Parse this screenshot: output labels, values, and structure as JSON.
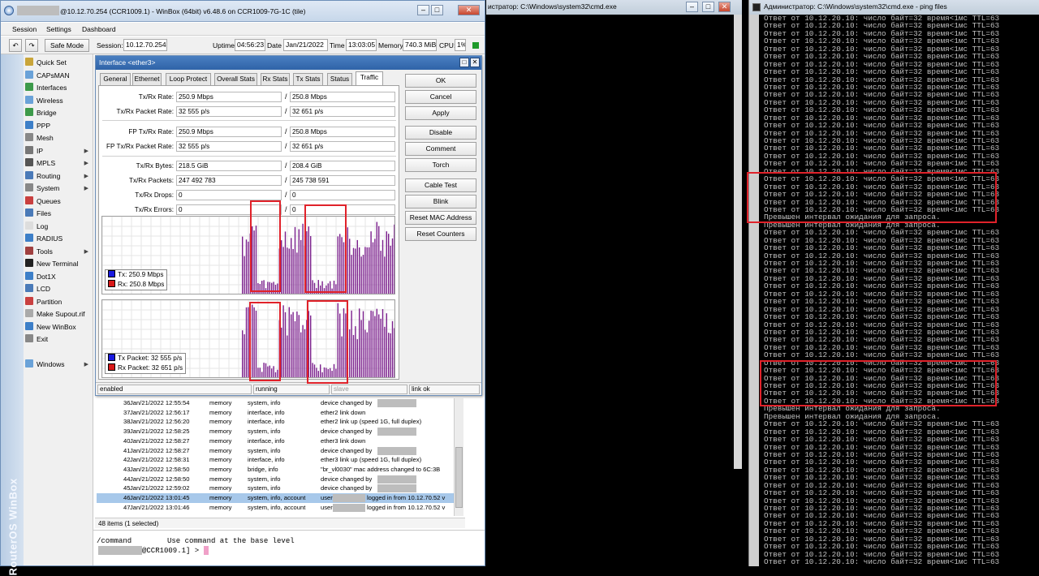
{
  "winbox": {
    "title_prefix": "@10.12.70.254 (CCR1009.1) - WinBox (64bit) v6.48.6 on CCR1009-7G-1C (tile)",
    "menu": [
      "Session",
      "Settings",
      "Dashboard"
    ],
    "toolbar": {
      "safe_mode": "Safe Mode",
      "session_label": "Session:",
      "session_value": "10.12.70.254",
      "uptime_label": "Uptime",
      "uptime_value": "04:56:23",
      "date_label": "Date",
      "date_value": "Jan/21/2022",
      "time_label": "Time",
      "time_value": "13:03:05",
      "memory_label": "Memory:",
      "memory_value": "740.3 MiB",
      "cpu_label": "CPU:",
      "cpu_value": "1%"
    },
    "vertical_brand": "RouterOS WinBox",
    "sidebar": [
      {
        "label": "Quick Set",
        "icon": "quickset-icon",
        "color": "#c9a53a",
        "arrow": false
      },
      {
        "label": "CAPsMAN",
        "icon": "capsman-icon",
        "color": "#6aa2d8",
        "arrow": false
      },
      {
        "label": "Interfaces",
        "icon": "interfaces-icon",
        "color": "#3d9a4a",
        "arrow": false
      },
      {
        "label": "Wireless",
        "icon": "wireless-icon",
        "color": "#6aa2d8",
        "arrow": false
      },
      {
        "label": "Bridge",
        "icon": "bridge-icon",
        "color": "#3d9a4a",
        "arrow": false
      },
      {
        "label": "PPP",
        "icon": "ppp-icon",
        "color": "#3d7fc8",
        "arrow": false
      },
      {
        "label": "Mesh",
        "icon": "mesh-icon",
        "color": "#888888",
        "arrow": false
      },
      {
        "label": "IP",
        "icon": "ip-icon",
        "color": "#777777",
        "arrow": true
      },
      {
        "label": "MPLS",
        "icon": "mpls-icon",
        "color": "#555555",
        "arrow": true
      },
      {
        "label": "Routing",
        "icon": "routing-icon",
        "color": "#4a7ab8",
        "arrow": true
      },
      {
        "label": "System",
        "icon": "system-icon",
        "color": "#888888",
        "arrow": true
      },
      {
        "label": "Queues",
        "icon": "queues-icon",
        "color": "#c94040",
        "arrow": false
      },
      {
        "label": "Files",
        "icon": "files-icon",
        "color": "#4a7ab8",
        "arrow": false
      },
      {
        "label": "Log",
        "icon": "log-icon",
        "color": "#dddddd",
        "arrow": false
      },
      {
        "label": "RADIUS",
        "icon": "radius-icon",
        "color": "#3d7fc8",
        "arrow": false
      },
      {
        "label": "Tools",
        "icon": "tools-icon",
        "color": "#a04040",
        "arrow": true
      },
      {
        "label": "New Terminal",
        "icon": "terminal-icon",
        "color": "#222222",
        "arrow": false
      },
      {
        "label": "Dot1X",
        "icon": "dot1x-icon",
        "color": "#3d7fc8",
        "arrow": false
      },
      {
        "label": "LCD",
        "icon": "lcd-icon",
        "color": "#4a7ab8",
        "arrow": false
      },
      {
        "label": "Partition",
        "icon": "partition-icon",
        "color": "#c94040",
        "arrow": false
      },
      {
        "label": "Make Supout.rif",
        "icon": "supout-icon",
        "color": "#aaaaaa",
        "arrow": false
      },
      {
        "label": "New WinBox",
        "icon": "winbox-icon",
        "color": "#3d7fc8",
        "arrow": false
      },
      {
        "label": "Exit",
        "icon": "exit-icon",
        "color": "#888888",
        "arrow": false
      },
      {
        "label": "Windows",
        "icon": "windows-icon",
        "color": "#6aa2d8",
        "arrow": true
      }
    ],
    "log": {
      "rows": [
        {
          "n": "36",
          "time": "Jan/21/2022 12:55:54",
          "buf": "memory",
          "topics": "system, info",
          "msg": "device changed by",
          "redacted": true,
          "selected": false
        },
        {
          "n": "37",
          "time": "Jan/21/2022 12:56:17",
          "buf": "memory",
          "topics": "interface, info",
          "msg": "ether2 link down",
          "redacted": false,
          "selected": false
        },
        {
          "n": "38",
          "time": "Jan/21/2022 12:56:20",
          "buf": "memory",
          "topics": "interface, info",
          "msg": "ether2 link up (speed 1G, full duplex)",
          "redacted": false,
          "selected": false
        },
        {
          "n": "39",
          "time": "Jan/21/2022 12:58:25",
          "buf": "memory",
          "topics": "system, info",
          "msg": "device changed by",
          "redacted": true,
          "selected": false
        },
        {
          "n": "40",
          "time": "Jan/21/2022 12:58:27",
          "buf": "memory",
          "topics": "interface, info",
          "msg": "ether3 link down",
          "redacted": false,
          "selected": false
        },
        {
          "n": "41",
          "time": "Jan/21/2022 12:58:27",
          "buf": "memory",
          "topics": "system, info",
          "msg": "device changed by",
          "redacted": true,
          "selected": false
        },
        {
          "n": "42",
          "time": "Jan/21/2022 12:58:31",
          "buf": "memory",
          "topics": "interface, info",
          "msg": "ether3 link up (speed 1G, full duplex)",
          "redacted": false,
          "selected": false
        },
        {
          "n": "43",
          "time": "Jan/21/2022 12:58:50",
          "buf": "memory",
          "topics": "bridge, info",
          "msg": "\"br_vl0030\" mac address changed to 6C:3B",
          "redacted": false,
          "selected": false
        },
        {
          "n": "44",
          "time": "Jan/21/2022 12:58:50",
          "buf": "memory",
          "topics": "system, info",
          "msg": "device changed by",
          "redacted": true,
          "selected": false
        },
        {
          "n": "45",
          "time": "Jan/21/2022 12:59:02",
          "buf": "memory",
          "topics": "system, info",
          "msg": "device changed by",
          "redacted": true,
          "selected": false
        },
        {
          "n": "46",
          "time": "Jan/21/2022 13:01:45",
          "buf": "memory",
          "topics": "system, info, account",
          "msg": "user",
          "msg2": "logged in from 10.12.70.52 v",
          "redacted": true,
          "selected": true
        },
        {
          "n": "47",
          "time": "Jan/21/2022 13:01:46",
          "buf": "memory",
          "topics": "system, info, account",
          "msg": "user",
          "msg2": "logged in from 10.12.70.52 v",
          "redacted": true,
          "selected": false
        }
      ],
      "status": "48 items (1 selected)"
    },
    "terminal": {
      "line1_cmd": "/command",
      "line1_desc": "Use command at the base level",
      "prompt_host": "@CCR1009.1] >"
    }
  },
  "interface": {
    "title": "Interface <ether3>",
    "tabs": [
      "General",
      "Ethernet",
      "Loop Protect",
      "Overall Stats",
      "Rx Stats",
      "Tx Stats",
      "Status",
      "Traffic"
    ],
    "active_tab": "Traffic",
    "fields": [
      {
        "label": "Tx/Rx Rate:",
        "tx": "250.9 Mbps",
        "rx": "250.8 Mbps"
      },
      {
        "label": "Tx/Rx Packet Rate:",
        "tx": "32 555 p/s",
        "rx": "32 651 p/s"
      },
      {
        "label": "FP Tx/Rx Rate:",
        "tx": "250.9 Mbps",
        "rx": "250.8 Mbps"
      },
      {
        "label": "FP Tx/Rx Packet Rate:",
        "tx": "32 555 p/s",
        "rx": "32 651 p/s"
      },
      {
        "label": "Tx/Rx Bytes:",
        "tx": "218.5 GiB",
        "rx": "208.4 GiB"
      },
      {
        "label": "Tx/Rx Packets:",
        "tx": "247 492 783",
        "rx": "245 738 591"
      },
      {
        "label": "Tx/Rx Drops:",
        "tx": "0",
        "rx": "0"
      },
      {
        "label": "Tx/Rx Errors:",
        "tx": "0",
        "rx": "0"
      }
    ],
    "legend_rate": {
      "tx": "Tx:  250.9 Mbps",
      "rx": "Rx:  250.8 Mbps"
    },
    "legend_packet": {
      "tx": "Tx Packet:  32 555 p/s",
      "rx": "Rx Packet:  32 651 p/s"
    },
    "buttons": [
      "OK",
      "Cancel",
      "Apply",
      "Disable",
      "Comment",
      "Torch",
      "Cable Test",
      "Blink",
      "Reset MAC Address",
      "Reset Counters"
    ],
    "status": [
      "enabled",
      "running",
      "slave",
      "link ok"
    ],
    "colors": {
      "tx": "#1a1ae0",
      "rx": "#d81818",
      "bars": "#7a1f8c"
    }
  },
  "cmd_mid": {
    "title": "истратор: C:\\Windows\\system32\\cmd.exe"
  },
  "cmd_right": {
    "title": "Администратор: C:\\Windows\\system32\\cmd.exe - ping  files",
    "reply": "Ответ от 10.12.20.10: число байт=32 время<1мс TTL=63",
    "timeout": "Превышен интервал ожидания для запроса.",
    "pattern": [
      "r",
      "r",
      "r",
      "r",
      "r",
      "r",
      "r",
      "r",
      "r",
      "r",
      "r",
      "r",
      "r",
      "r",
      "r",
      "r",
      "r",
      "r",
      "r",
      "r",
      "r",
      "r",
      "r",
      "r",
      "r",
      "r",
      "t",
      "t",
      "r",
      "r",
      "r",
      "r",
      "r",
      "r",
      "r",
      "r",
      "r",
      "r",
      "r",
      "r",
      "r",
      "r",
      "r",
      "r",
      "r",
      "r",
      "r",
      "r",
      "r",
      "r",
      "r",
      "t",
      "t",
      "r",
      "r",
      "r",
      "r",
      "r",
      "r",
      "r",
      "r",
      "r",
      "r",
      "r",
      "r",
      "r",
      "r",
      "r",
      "r",
      "r",
      "r",
      "r",
      "r",
      "r"
    ]
  }
}
